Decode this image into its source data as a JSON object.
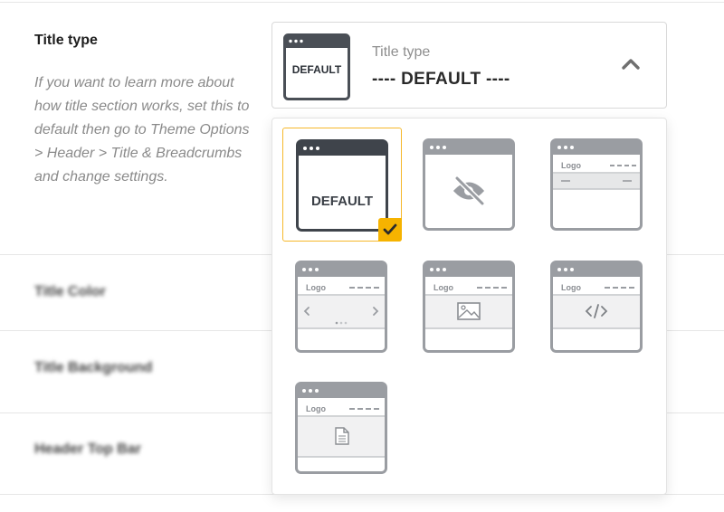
{
  "setting": {
    "label": "Title type",
    "description": "If you want to learn more about how title section works, set this to default then go to Theme Options > Header > Title & Breadcrumbs and change settings."
  },
  "select": {
    "label": "Title type",
    "value": "---- DEFAULT ----",
    "thumb_text": "DEFAULT",
    "icon": "chevron-up-icon"
  },
  "options": [
    {
      "name": "default",
      "text": "DEFAULT",
      "selected": true,
      "icon": "check-icon"
    },
    {
      "name": "hidden",
      "icon": "eye-slash-icon",
      "selected": false
    },
    {
      "name": "solid",
      "logo": "Logo",
      "selected": false
    },
    {
      "name": "slider",
      "logo": "Logo",
      "icon": "slider-arrows-icon",
      "selected": false
    },
    {
      "name": "image",
      "logo": "Logo",
      "icon": "image-icon",
      "selected": false
    },
    {
      "name": "custom-code",
      "logo": "Logo",
      "icon": "code-icon",
      "selected": false
    },
    {
      "name": "page",
      "logo": "Logo",
      "icon": "document-icon",
      "selected": false
    }
  ],
  "other_rows": [
    {
      "label": "Title Color"
    },
    {
      "label": "Title Background"
    },
    {
      "label": "Header Top Bar"
    }
  ],
  "colors": {
    "accent": "#f6b300",
    "frame": "#4a4f56",
    "frame_muted": "#9a9da2",
    "panel": "#f3f3f3"
  }
}
